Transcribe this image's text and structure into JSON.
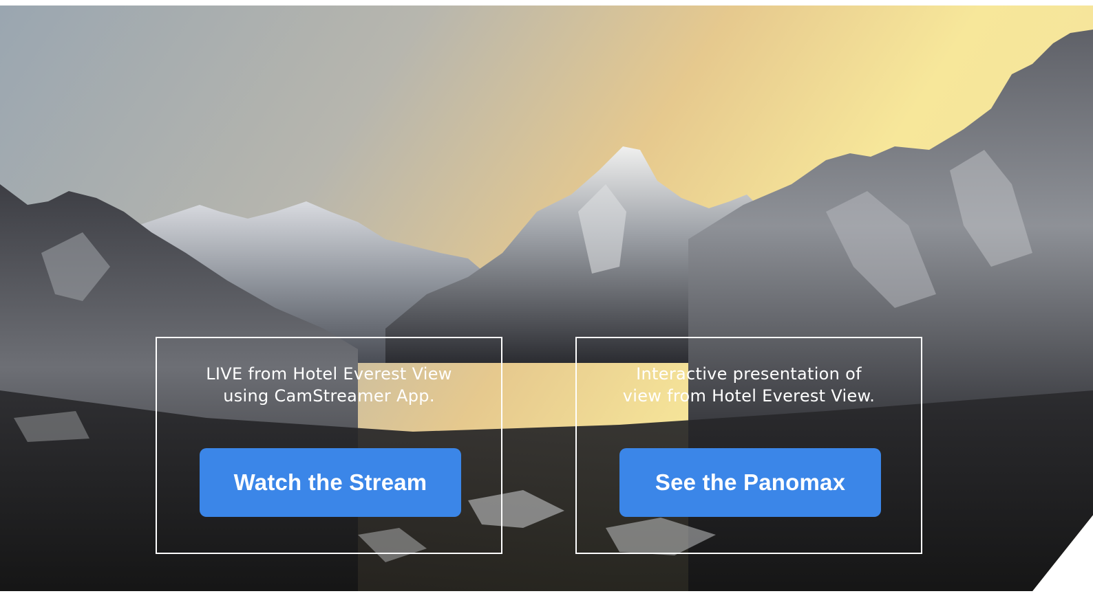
{
  "hero": {
    "background_image": "himalaya-mountain-sunrise-webcam-view"
  },
  "cards": [
    {
      "line1": "LIVE from Hotel Everest View",
      "line2": "using CamStreamer App.",
      "button_label": "Watch the Stream"
    },
    {
      "line1": "Interactive presentation of",
      "line2": "view from Hotel Everest View.",
      "button_label": "See the Panomax"
    }
  ],
  "colors": {
    "button": "#3b86e8",
    "card_border": "#ffffff",
    "text": "#ffffff"
  }
}
